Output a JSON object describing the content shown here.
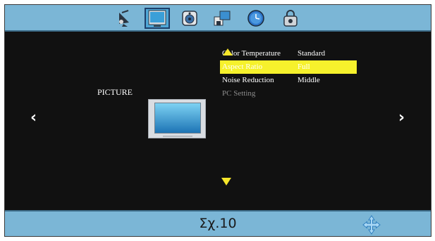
{
  "tabs": [
    {
      "name": "channel",
      "icon": "satellite-dish-icon",
      "active": false
    },
    {
      "name": "picture",
      "icon": "picture-screen-icon",
      "active": true
    },
    {
      "name": "sound",
      "icon": "speaker-icon",
      "active": false
    },
    {
      "name": "setup",
      "icon": "setup-icon",
      "active": false
    },
    {
      "name": "time",
      "icon": "clock-icon",
      "active": false
    },
    {
      "name": "lock",
      "icon": "lock-icon",
      "active": false
    }
  ],
  "section": {
    "title": "PICTURE"
  },
  "menu": {
    "items": [
      {
        "label": "Color Temperature",
        "value": "Standard"
      },
      {
        "label": "Aspect Ratio",
        "value": "Full",
        "selected": true
      },
      {
        "label": "Noise Reduction",
        "value": "Middle"
      },
      {
        "label": "PC Setting",
        "value": "",
        "disabled": true
      }
    ]
  },
  "navigation": {
    "left_glyph": "‹",
    "right_glyph": "›"
  },
  "footer": {
    "caption": "Σχ.10",
    "move_icon": "four-way-arrow-icon"
  },
  "colors": {
    "bar_blue": "#7bb6d6",
    "highlight_yellow": "#f6f12c",
    "background": "#111111"
  }
}
